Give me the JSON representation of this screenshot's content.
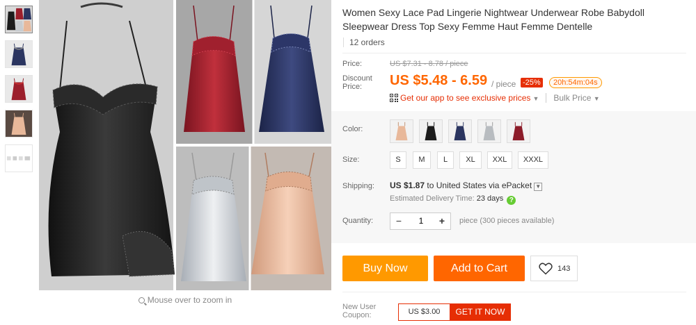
{
  "product": {
    "title": "Women Sexy Lace Pad Lingerie Nightwear Underwear Robe Babydoll Sleepwear Dress Top Sexy Femme Haut Femme Dentelle",
    "orders": "12 orders"
  },
  "gallery": {
    "zoom_hint": "Mouse over to zoom in",
    "thumb_icons": [
      "dress-collage-thumbnail",
      "navy-dress-thumbnail",
      "red-dress-thumbnail",
      "apricot-dress-thumbnail",
      "placeholder-thumbnail"
    ],
    "main_image": "dress-collage-image"
  },
  "price": {
    "label": "Price:",
    "original": "US $7.31 - 8.78 / piece",
    "discount_label": "Discount Price:",
    "discount": "US $5.48 - 6.59",
    "per": "/ piece",
    "badge": "-25%",
    "timer": "20h:54m:04s",
    "app_link": "Get our app to see exclusive prices",
    "bulk": "Bulk Price"
  },
  "colors": {
    "label": "Color:",
    "options": [
      {
        "name": "Apricot",
        "hex": "#e8b89a"
      },
      {
        "name": "Black",
        "hex": "#1c1c1c"
      },
      {
        "name": "Navy Blue",
        "hex": "#2b3560"
      },
      {
        "name": "Silver",
        "hex": "#c8ccd0"
      },
      {
        "name": "Wine Red",
        "hex": "#8c1c2a"
      }
    ]
  },
  "sizes": {
    "label": "Size:",
    "options": [
      "S",
      "M",
      "L",
      "XL",
      "XXL",
      "XXXL"
    ]
  },
  "shipping": {
    "label": "Shipping:",
    "cost": "US $1.87",
    "to": "to",
    "country": "United States",
    "via": "via ePacket",
    "est_label": "Estimated Delivery Time:",
    "days": "23 days"
  },
  "quantity": {
    "label": "Quantity:",
    "value": "1",
    "available": "piece (300 pieces available)"
  },
  "actions": {
    "buy_now": "Buy Now",
    "add_to_cart": "Add to Cart",
    "wishlist_count": "143"
  },
  "coupon": {
    "label": "New User Coupon:",
    "amount": "US $3.00",
    "get": "GET IT NOW"
  },
  "colors_theme": {
    "accent": "#ff6600",
    "buy_now": "#ff9900",
    "red": "#e62e04"
  }
}
